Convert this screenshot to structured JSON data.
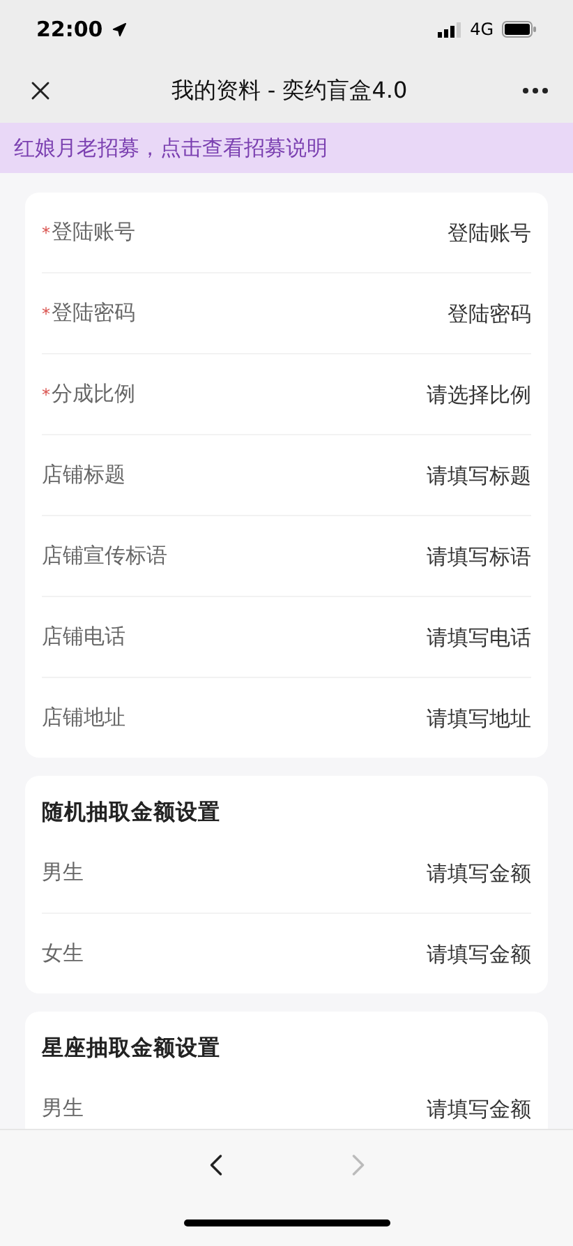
{
  "status_bar": {
    "time": "22:00",
    "network": "4G"
  },
  "nav_bar": {
    "title": "我的资料 - 奕约盲盒4.0"
  },
  "banner": {
    "text": "红娘月老招募，点击查看招募说明"
  },
  "sections": [
    {
      "fields": [
        {
          "required_mark": "*",
          "label": "登陆账号",
          "placeholder": "登陆账号"
        },
        {
          "required_mark": "*",
          "label": "登陆密码",
          "placeholder": "登陆密码"
        },
        {
          "required_mark": "*",
          "label": "分成比例",
          "placeholder": "请选择比例"
        },
        {
          "label": "店铺标题",
          "placeholder": "请填写标题"
        },
        {
          "label": "店铺宣传标语",
          "placeholder": "请填写标语"
        },
        {
          "label": "店铺电话",
          "placeholder": "请填写电话"
        },
        {
          "label": "店铺地址",
          "placeholder": "请填写地址"
        }
      ]
    },
    {
      "title": "随机抽取金额设置",
      "fields": [
        {
          "label": "男生",
          "placeholder": "请填写金额"
        },
        {
          "label": "女生",
          "placeholder": "请填写金额"
        }
      ]
    },
    {
      "title": "星座抽取金额设置",
      "fields": [
        {
          "label": "男生",
          "placeholder": "请填写金额"
        }
      ]
    }
  ],
  "toolbar": {
    "back": {
      "disabled": false
    },
    "forward": {
      "disabled": true
    }
  }
}
